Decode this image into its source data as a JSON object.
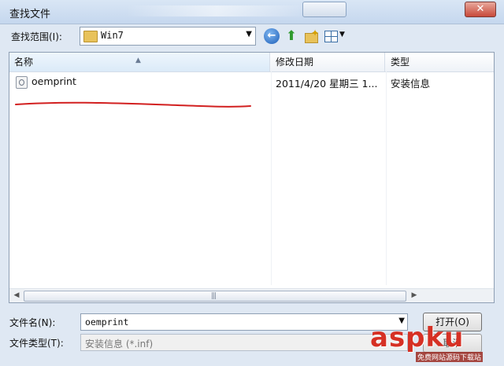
{
  "window": {
    "title": "查找文件",
    "close_glyph": "✕"
  },
  "toolbar": {
    "look_in_label": "查找范围(I):",
    "look_in_value": "Win7",
    "back_glyph": "←",
    "up_glyph": "⬆",
    "dropdown_glyph": "▼"
  },
  "list": {
    "columns": [
      "名称",
      "修改日期",
      "类型"
    ],
    "rows": [
      {
        "name": "oemprint",
        "date": "2011/4/20 星期三 1...",
        "type": "安装信息"
      }
    ],
    "scroll_grip": "|||"
  },
  "footer": {
    "filename_label": "文件名(N):",
    "filename_value": "oemprint",
    "filetype_label": "文件类型(T):",
    "filetype_value": "安装信息 (*.inf)",
    "open_label": "打开(O)",
    "cancel_label": "取消"
  },
  "watermark": {
    "text": "aspku",
    "sub": "免费网站源码下载站"
  },
  "colors": {
    "annotation": "#d22020",
    "accent": "#1d5fb8"
  }
}
